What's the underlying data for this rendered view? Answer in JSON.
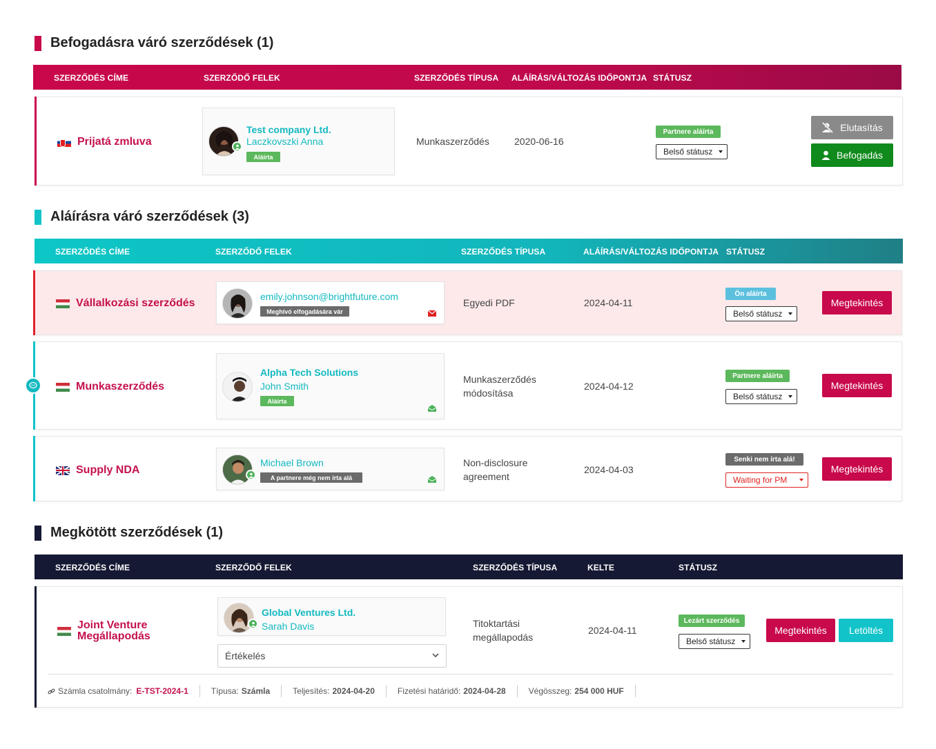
{
  "colors": {
    "accent_red": "#c8094b",
    "accent_teal": "#12c4c9",
    "dark": "#161933",
    "ok_green": "#108a1c"
  },
  "section1": {
    "title": "Befogadásra váró szerződések (1)",
    "headers": [
      "SZERZŐDÉS CÍME",
      "SZERZŐDŐ FELEK",
      "SZERZŐDÉS TÍPUSA",
      "ALÁÍRÁS/VÁLTOZÁS IDŐPONTJA",
      "STÁTUSZ"
    ],
    "rows": [
      {
        "title": "Prijatá zmluva",
        "flag": "slovakia-flag",
        "company": "Test company Ltd.",
        "person": "Laczkovszki Anna",
        "tag": "Aláírta",
        "type": "Munkaszerződés",
        "date": "2020-06-16",
        "status": "Partnere aláírta",
        "internal_status": "Belső státusz",
        "reject_label": "Elutasítás",
        "accept_label": "Befogadás"
      }
    ]
  },
  "section2": {
    "title": "Aláírásra váró szerződések (3)",
    "headers": [
      "SZERZŐDÉS CÍME",
      "SZERZŐDŐ FELEK",
      "SZERZŐDÉS TÍPUSA",
      "ALÁÍRÁS/VÁLTOZÁS IDŐPONTJA",
      "STÁTUSZ"
    ],
    "rows": [
      {
        "title": "Vállalkozási szerződés",
        "flag": "hungary-flag",
        "person": "emily.johnson@brightfuture.com",
        "tag": "Meghívó elfogadására vár",
        "type": "Egyedi PDF",
        "date": "2024-04-11",
        "status": "Ön aláírta",
        "internal_status": "Belső státusz",
        "view_label": "Megtekintés"
      },
      {
        "title": "Munkaszerződés",
        "flag": "hungary-flag",
        "company": "Alpha Tech Solutions",
        "person": "John Smith",
        "tag": "Aláírta",
        "type_line1": "Munkaszerződés",
        "type_line2": "módosítása",
        "date": "2024-04-12",
        "status": "Partnere aláírta",
        "internal_status": "Belső státusz",
        "view_label": "Megtekintés"
      },
      {
        "title": "Supply NDA",
        "flag": "uk-flag",
        "person": "Michael Brown",
        "tag": "A partnere még nem írta alá",
        "type_line1": "Non-disclosure",
        "type_line2": "agreement",
        "date": "2024-04-03",
        "status": "Senki nem írta alá!",
        "internal_status": "Waiting for PM",
        "view_label": "Megtekintés"
      }
    ]
  },
  "section3": {
    "title": "Megkötött szerződések (1)",
    "headers": [
      "SZERZŐDÉS CÍME",
      "SZERZŐDŐ FELEK",
      "SZERZŐDÉS TÍPUSA",
      "KELTE",
      "STÁTUSZ"
    ],
    "rows": [
      {
        "title_line1": "Joint Venture",
        "title_line2": "Megállapodás",
        "flag": "hungary-flag",
        "company": "Global Ventures Ltd.",
        "person": "Sarah Davis",
        "evaluation": "Értékelés",
        "type_line1": "Titoktartási",
        "type_line2": "megállapodás",
        "date": "2024-04-11",
        "status": "Lezárt szerződés",
        "internal_status": "Belső státusz",
        "view_label": "Megtekintés",
        "download_label": "Letöltés",
        "footer": {
          "invoice_label": "Számla csatolmány:",
          "invoice_value": "E-TST-2024-1",
          "type_label": "Típusa:",
          "type_value": "Számla",
          "fulfil_label": "Teljesítés:",
          "fulfil_value": "2024-04-20",
          "due_label": "Fizetési határidő:",
          "due_value": "2024-04-28",
          "total_label": "Végösszeg:",
          "total_value": "254 000 HUF"
        }
      }
    ]
  }
}
